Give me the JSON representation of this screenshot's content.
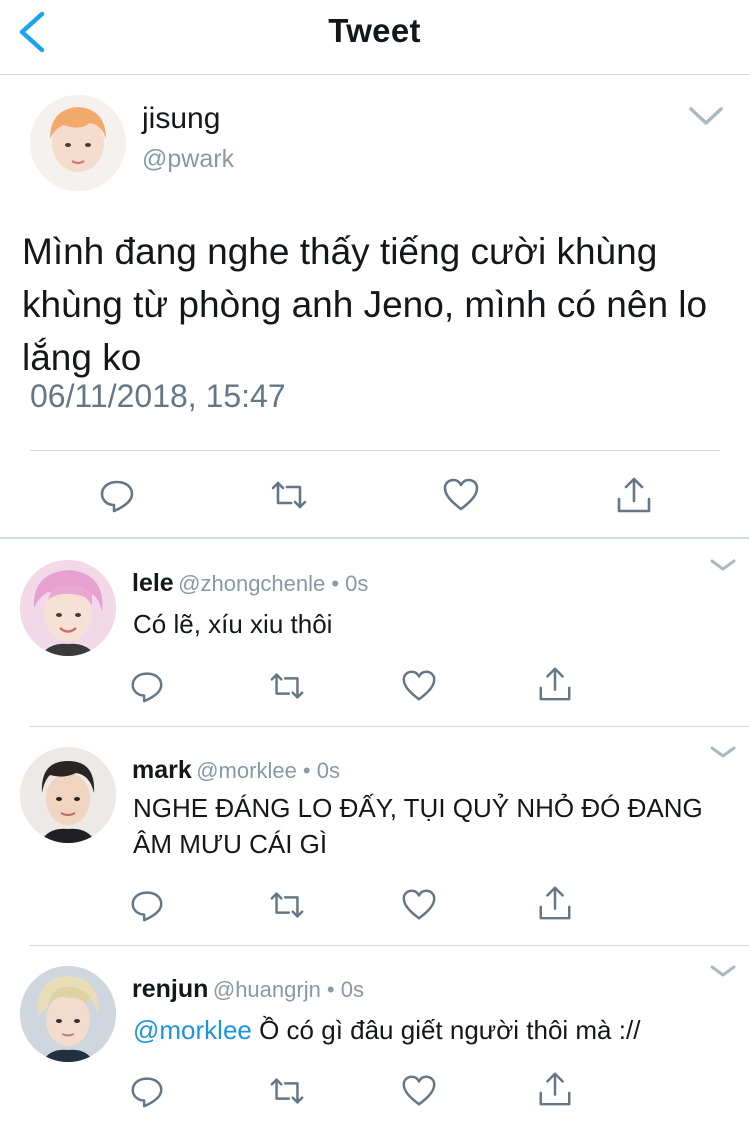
{
  "header": {
    "title": "Tweet"
  },
  "main_tweet": {
    "name": "jisung",
    "handle": "@pwark",
    "text": "Mình đang nghe thấy tiếng cười khùng khùng từ phòng anh Jeno, mình có nên lo lắng ko",
    "timestamp": "06/11/2018, 15:47"
  },
  "replies": [
    {
      "name": "lele",
      "meta": "@zhongchenle • 0s",
      "text": "Có lẽ, xíu xiu thôi",
      "mention": ""
    },
    {
      "name": "mark",
      "meta": "@morklee • 0s",
      "text": "NGHE ĐÁNG LO ĐẤY, TỤI QUỶ NHỎ ĐÓ ĐANG ÂM MƯU CÁI GÌ",
      "mention": ""
    },
    {
      "name": "renjun",
      "meta": "@huangrjn • 0s",
      "text": " Ồ có gì đâu giết người thôi mà ://",
      "mention": "@morklee"
    }
  ],
  "icons": {
    "back": "chevron-left-icon",
    "caret": "chevron-down-icon",
    "reply": "reply-icon",
    "retweet": "retweet-icon",
    "like": "heart-icon",
    "share": "share-icon"
  },
  "colors": {
    "accent": "#1da1f2",
    "text": "#14171a",
    "secondary": "#657786",
    "mention": "#1b95e0",
    "divider": "#d4d9dd"
  }
}
